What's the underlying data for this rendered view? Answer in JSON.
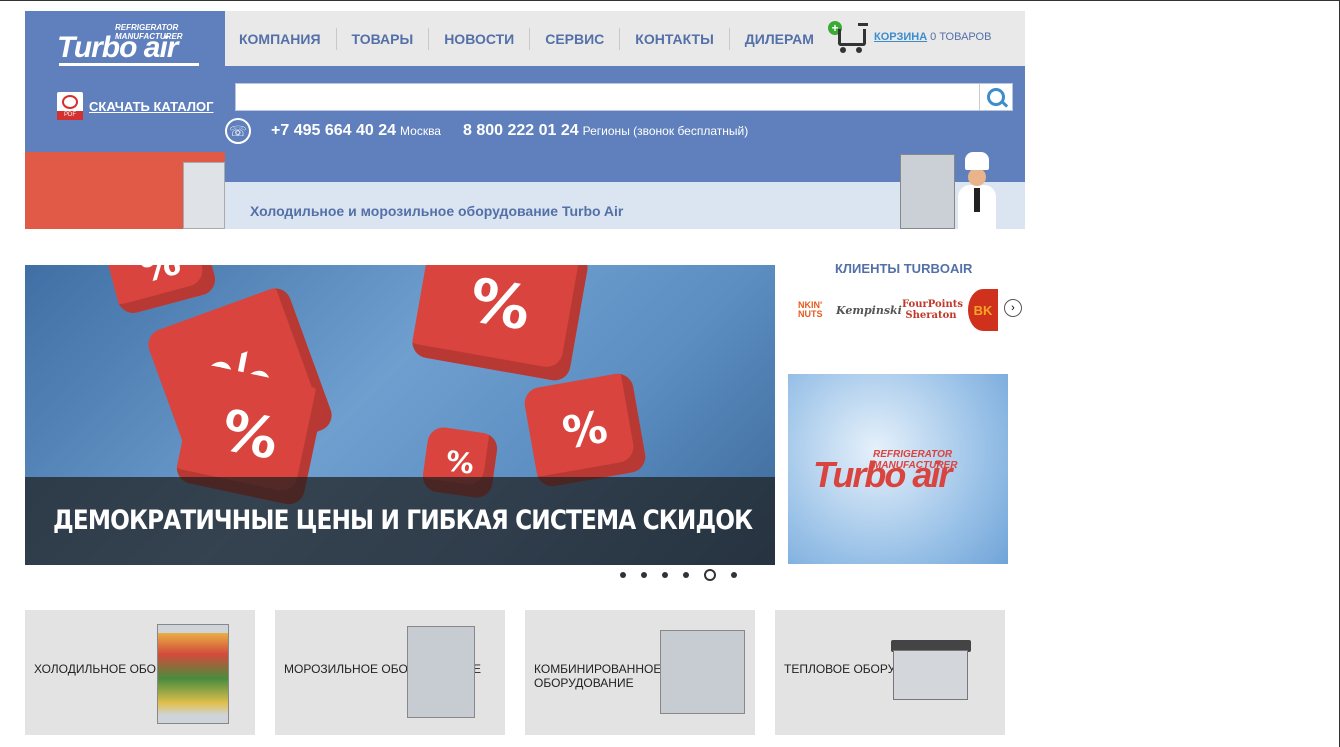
{
  "header": {
    "logo_text": "Turbo air",
    "logo_tagline": "REFRIGERATOR MANUFACTURER",
    "catalog_link": "СКАЧАТЬ КАТАЛОГ",
    "pdf_label": "PDF",
    "nav": [
      "КОМПАНИЯ",
      "ТОВАРЫ",
      "НОВОСТИ",
      "СЕРВИС",
      "КОНТАКТЫ",
      "ДИЛЕРАМ"
    ],
    "cart_link": "КОРЗИНА",
    "cart_count": "0 ТОВАРОВ",
    "search_placeholder": "",
    "phone1": "+7 495 664 40 24",
    "phone1_label": "Москва",
    "phone2": "8 800 222 01 24",
    "phone2_label": "Регионы (звонок бесплатный)"
  },
  "banner": {
    "text": "Холодильное и морозильное оборудование Turbo Air"
  },
  "slider": {
    "caption": "ДЕМОКРАТИЧНЫЕ ЦЕНЫ И ГИБКАЯ СИСТЕМА СКИДОК",
    "die_symbol": "%",
    "slide_count": 6,
    "active_slide": 5
  },
  "clients": {
    "title": "КЛИЕНТЫ TURBOAIR",
    "logos": [
      "NKIN' NUTS",
      "Kempinski",
      "FourPoints Sheraton",
      "BURGER KING"
    ]
  },
  "promo": {
    "logo_text": "Turbo air",
    "tagline": "REFRIGERATOR MANUFACTURER"
  },
  "categories": [
    {
      "label": "ХОЛОДИЛЬНОЕ ОБОРУДОВАНИЕ"
    },
    {
      "label": "МОРОЗИЛЬНОЕ ОБОРУДОВАНИЕ"
    },
    {
      "label": "КОМБИНИРОВАННОЕ ОБОРУДОВАНИЕ"
    },
    {
      "label": "ТЕПЛОВОЕ ОБОРУДОВАНИЕ"
    }
  ],
  "colors": {
    "brand_blue": "#5f80bd",
    "nav_text": "#5470a8",
    "accent_red": "#d9443e",
    "link_blue": "#3c8dcc"
  },
  "icons": [
    "pdf-icon",
    "cart-icon",
    "search-icon",
    "phone-icon",
    "chevron-right-icon"
  ]
}
